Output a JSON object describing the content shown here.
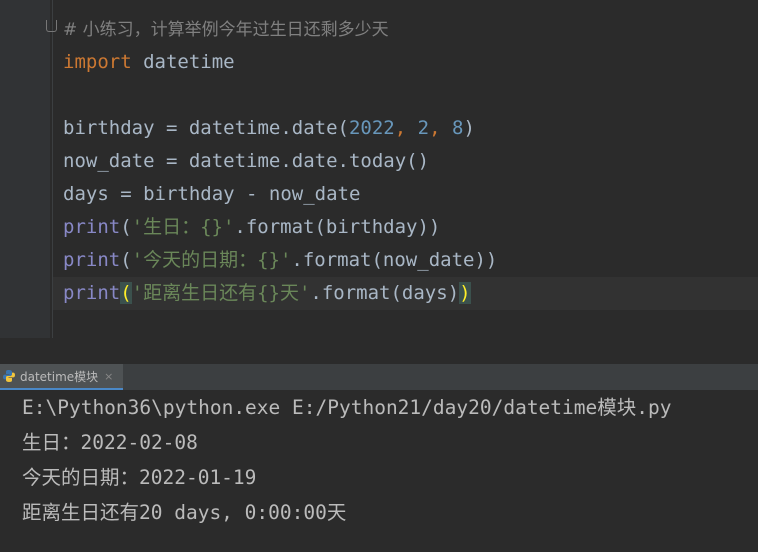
{
  "editor": {
    "lines": [
      {
        "parts": [
          {
            "t": "# 小练习，计算举例今年过生日还剩多少天",
            "c": "cmt"
          }
        ]
      },
      {
        "parts": [
          {
            "t": "import",
            "c": "kw"
          },
          {
            "t": " datetime",
            "c": ""
          }
        ]
      },
      {
        "parts": []
      },
      {
        "parts": [
          {
            "t": "birthday = datetime.date(",
            "c": ""
          },
          {
            "t": "2022",
            "c": "num"
          },
          {
            "t": ", ",
            "c": "kw"
          },
          {
            "t": "2",
            "c": "num"
          },
          {
            "t": ", ",
            "c": "kw"
          },
          {
            "t": "8",
            "c": "num"
          },
          {
            "t": ")",
            "c": ""
          }
        ]
      },
      {
        "parts": [
          {
            "t": "now_date = datetime.date.today()",
            "c": ""
          }
        ]
      },
      {
        "parts": [
          {
            "t": "days = birthday - now_date",
            "c": ""
          }
        ]
      },
      {
        "parts": [
          {
            "t": "print",
            "c": "bi"
          },
          {
            "t": "(",
            "c": ""
          },
          {
            "t": "'生日：{}'",
            "c": "str"
          },
          {
            "t": ".format(birthday))",
            "c": ""
          }
        ]
      },
      {
        "parts": [
          {
            "t": "print",
            "c": "bi"
          },
          {
            "t": "(",
            "c": ""
          },
          {
            "t": "'今天的日期：{}'",
            "c": "str"
          },
          {
            "t": ".format(now_date))",
            "c": ""
          }
        ]
      },
      {
        "parts": [
          {
            "t": "print",
            "c": "bi"
          },
          {
            "t": "(",
            "c": "pb"
          },
          {
            "t": "'距离生日还有{}天'",
            "c": "str"
          },
          {
            "t": ".format(days)",
            "c": ""
          },
          {
            "t": ")",
            "c": "pb"
          }
        ]
      }
    ]
  },
  "run_tab": {
    "label": "datetime模块",
    "close": "×",
    "icon": "python-icon"
  },
  "console": {
    "lines": [
      "E:\\Python36\\python.exe E:/Python21/day20/datetime模块.py",
      "生日：2022-02-08",
      "今天的日期：2022-01-19",
      "距离生日还有20 days, 0:00:00天"
    ]
  },
  "colors": {
    "background": "#2b2b2b",
    "keyword": "#cc7832",
    "number": "#6897bb",
    "string": "#6a8759",
    "builtin": "#8888c6",
    "comment": "#808080"
  }
}
